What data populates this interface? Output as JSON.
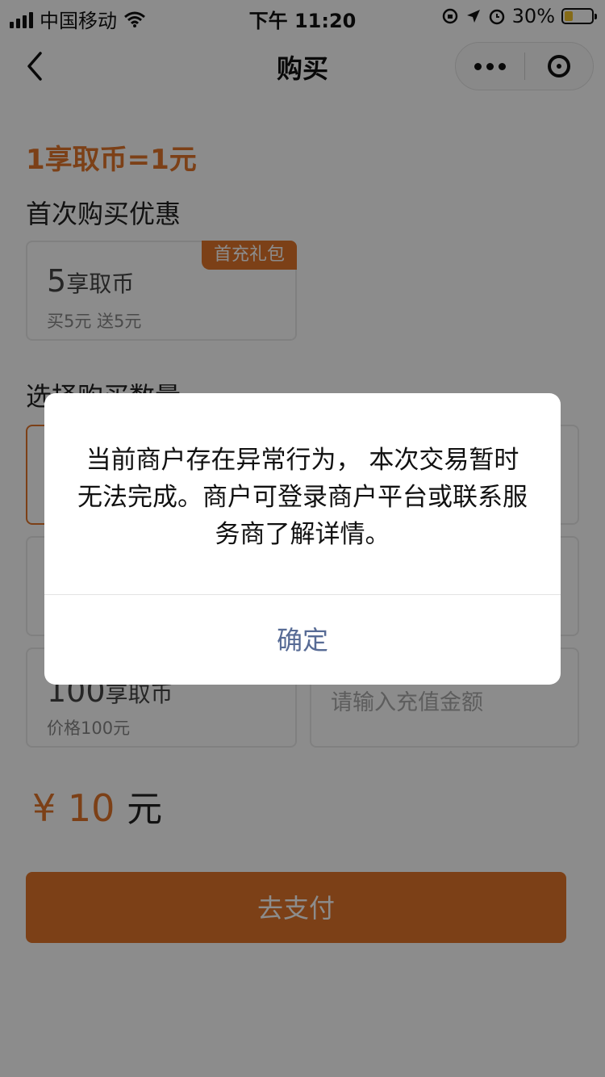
{
  "status_bar": {
    "carrier": "中国移动",
    "time": "下午 11:20",
    "battery_percent": "30%",
    "battery_level": 0.3
  },
  "nav": {
    "title": "购买"
  },
  "rate": "1享取币=1元",
  "first_purchase": {
    "heading": "首次购买优惠",
    "badge": "首充礼包",
    "amount": "5",
    "unit": "享取币",
    "desc": "买5元 送5元"
  },
  "quantity": {
    "heading": "选择购买数量",
    "options": [
      {
        "amount": "100",
        "unit": "享取币",
        "desc": "价格100元"
      }
    ],
    "custom_placeholder": "请输入充值金额"
  },
  "total": {
    "currency": "¥",
    "value": "10",
    "unit": "元"
  },
  "pay_button": "去支付",
  "dialog": {
    "message": "当前商户存在异常行为， 本次交易暂时无法完成。商户可登录商户平台或联系服务商了解详情。",
    "confirm": "确定"
  },
  "colors": {
    "accent": "#e2762a",
    "dialog_button": "#576b95",
    "battery_fill": "#f3c32a"
  },
  "icons": [
    "signal-icon",
    "wifi-icon",
    "lock-rotation-icon",
    "location-icon",
    "alarm-icon",
    "battery-icon",
    "back-arrow-icon",
    "more-dots-icon",
    "close-target-icon"
  ]
}
